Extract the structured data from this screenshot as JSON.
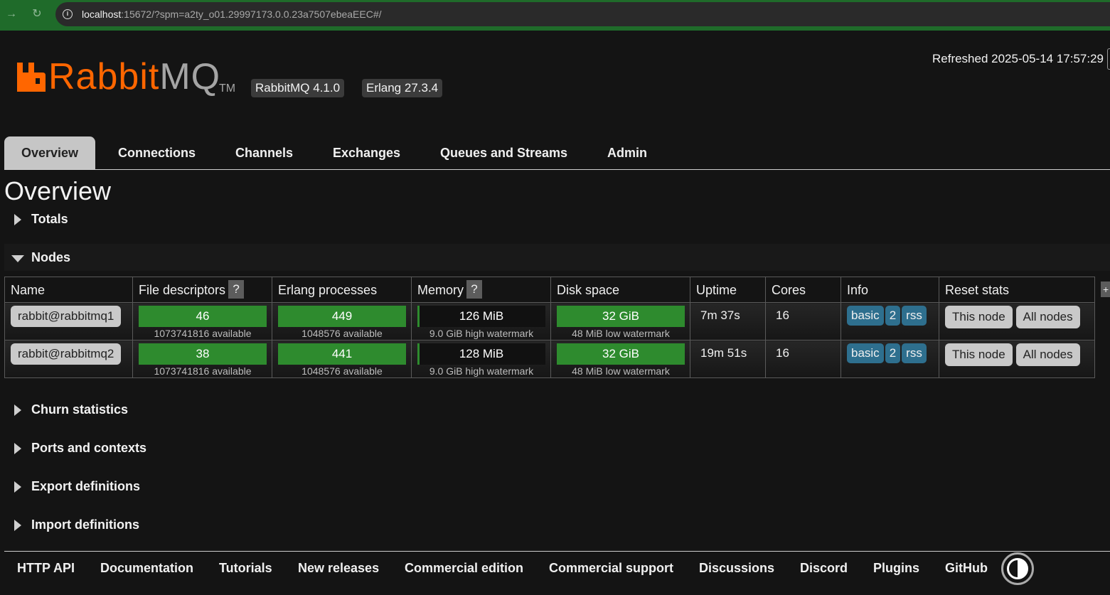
{
  "browser": {
    "url_host": "localhost",
    "url_rest": ":15672/?spm=a2ty_o01.29997173.0.0.23a7507ebeaEEC#/"
  },
  "header": {
    "logo_rabbit": "Rabbit",
    "logo_mq": "MQ",
    "logo_tm": "TM",
    "rabbitmq_version": "RabbitMQ 4.1.0",
    "erlang_version": "Erlang 27.3.4",
    "refreshed": "Refreshed 2025-05-14 17:57:29"
  },
  "tabs": [
    "Overview",
    "Connections",
    "Channels",
    "Exchanges",
    "Queues and Streams",
    "Admin"
  ],
  "page_title": "Overview",
  "sections": {
    "totals": "Totals",
    "nodes": "Nodes",
    "churn": "Churn statistics",
    "ports": "Ports and contexts",
    "export": "Export definitions",
    "import": "Import definitions"
  },
  "table": {
    "headers": {
      "name": "Name",
      "fd": "File descriptors",
      "erlang": "Erlang processes",
      "memory": "Memory",
      "disk": "Disk space",
      "uptime": "Uptime",
      "cores": "Cores",
      "info": "Info",
      "reset": "Reset stats"
    },
    "help": "?",
    "plus": "+",
    "rows": [
      {
        "name": "rabbit@rabbitmq1",
        "fd": "46",
        "fd_sub": "1073741816 available",
        "erlang": "449",
        "erlang_sub": "1048576 available",
        "memory": "126 MiB",
        "memory_sub": "9.0 GiB high watermark",
        "memory_fraction": 0.014,
        "disk": "32 GiB",
        "disk_sub": "48 MiB low watermark",
        "uptime": "7m 37s",
        "cores": "16",
        "info": [
          "basic",
          "2",
          "rss"
        ],
        "reset": [
          "This node",
          "All nodes"
        ]
      },
      {
        "name": "rabbit@rabbitmq2",
        "fd": "38",
        "fd_sub": "1073741816 available",
        "erlang": "441",
        "erlang_sub": "1048576 available",
        "memory": "128 MiB",
        "memory_sub": "9.0 GiB high watermark",
        "memory_fraction": 0.014,
        "disk": "32 GiB",
        "disk_sub": "48 MiB low watermark",
        "uptime": "19m 51s",
        "cores": "16",
        "info": [
          "basic",
          "2",
          "rss"
        ],
        "reset": [
          "This node",
          "All nodes"
        ]
      }
    ]
  },
  "footer": [
    "HTTP API",
    "Documentation",
    "Tutorials",
    "New releases",
    "Commercial edition",
    "Commercial support",
    "Discussions",
    "Discord",
    "Plugins",
    "GitHub"
  ],
  "colors": {
    "brand_orange": "#ff6600",
    "bar_green": "#2e8b2e",
    "info_tag_blue": "#2e6f8e",
    "browser_green": "#1f6b2a"
  }
}
